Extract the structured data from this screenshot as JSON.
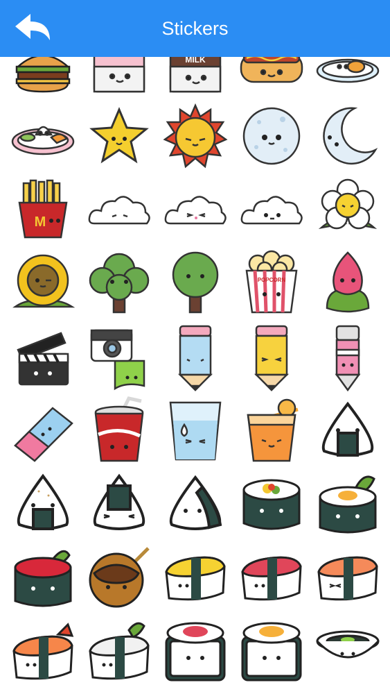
{
  "header": {
    "title": "Stickers",
    "background": "#2b8df3",
    "back_icon": "back-arrow-icon"
  },
  "stickers": [
    [
      "burger",
      "pink-milk-carton",
      "chocolate-milk-carton",
      "hotdog",
      "rice-plate"
    ],
    [
      "rice-plate-shrimp",
      "star",
      "sun",
      "full-moon",
      "crescent-moon"
    ],
    [
      "french-fries",
      "cloud-small",
      "cloud-pink",
      "cloud-round",
      "daisy"
    ],
    [
      "sunflower",
      "bush-tree",
      "round-tree",
      "popcorn",
      "flower-bud"
    ],
    [
      "clapperboard",
      "instant-camera",
      "blue-pencil",
      "yellow-pencil",
      "pink-pen"
    ],
    [
      "eraser",
      "soda-cup",
      "water-glass",
      "orange-juice",
      "onigiri"
    ],
    [
      "onigiri-sesame",
      "onigiri-nori",
      "onigiri-side",
      "sushi-roll",
      "sushi-roll-egg"
    ],
    [
      "ikura-gunkan",
      "takoyaki",
      "tamago-nigiri",
      "tuna-nigiri",
      "salmon-nigiri"
    ],
    [
      "shrimp-nigiri",
      "squid-nigiri",
      "tuna-maki",
      "salmon-maki",
      "soy-sauce-dish"
    ]
  ],
  "milk_label": "MILK",
  "popcorn_label": "POPCORN"
}
